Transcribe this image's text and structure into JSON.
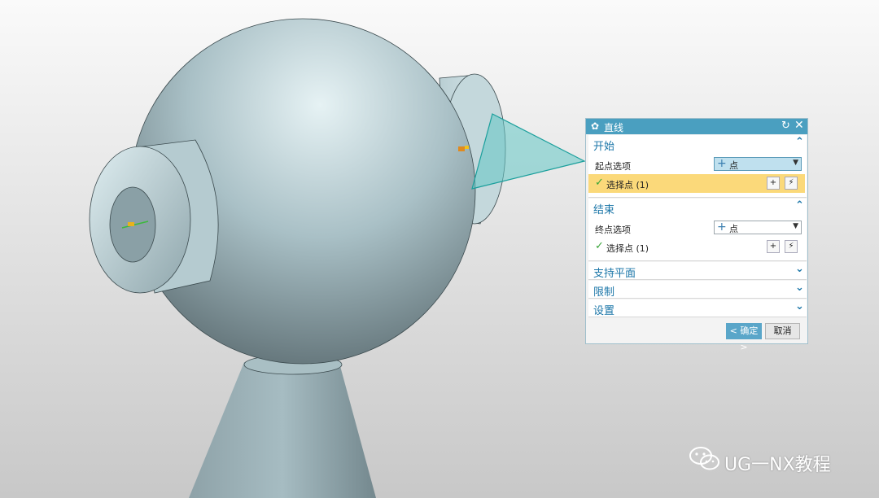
{
  "dialog": {
    "title": "直线",
    "sections": {
      "start": {
        "title": "开始",
        "option_label": "起点选项",
        "option_value": "点",
        "select_text": "选择点 (1)"
      },
      "end": {
        "title": "结束",
        "option_label": "终点选项",
        "option_value": "点",
        "select_text": "选择点 (1)"
      },
      "support_plane": {
        "title": "支持平面"
      },
      "limits": {
        "title": "限制"
      },
      "settings": {
        "title": "设置"
      }
    },
    "ok_label": "< 确定 >",
    "cancel_label": "取消"
  },
  "watermark": {
    "text": "UG一NX教程"
  },
  "colors": {
    "title_bar": "#4a9fc0",
    "section_title": "#1b76a8",
    "highlight_row": "#fbd97a",
    "model_surface": "#9fb6bc",
    "plane_fill": "#62c7c4"
  },
  "icons": [
    "gear-icon",
    "reset-icon",
    "close-icon",
    "chevron-up-icon",
    "chevron-down-icon",
    "point-plus-icon",
    "point-dialog-icon",
    "inferred-point-icon",
    "checkmark-icon",
    "wechat-icon"
  ]
}
